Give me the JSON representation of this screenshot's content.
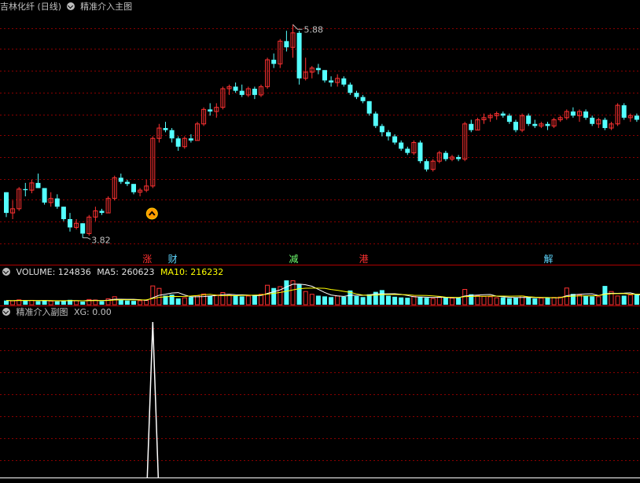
{
  "colors": {
    "background": "#000000",
    "up": "#ff3232",
    "down": "#54ffff",
    "grid": "#8a0000",
    "ma5": "#ffffff",
    "ma10": "#ffff00",
    "text": "#c0c0c0",
    "signal": "#ffffff"
  },
  "main_panel": {
    "stock_name": "吉林化纤",
    "period": "(日线)",
    "indicator": "精准介入主图",
    "high_label": "5.88",
    "low_label": "3.82",
    "buy_marker_icon": "chevron-up-icon",
    "news_labels": [
      {
        "text": "涨",
        "color": "#ff3030"
      },
      {
        "text": "财",
        "color": "#5fd7ff"
      },
      {
        "text": "减",
        "color": "#6fff6f"
      },
      {
        "text": "港",
        "color": "#ff3030"
      },
      {
        "text": "解",
        "color": "#5fd7ff"
      }
    ]
  },
  "volume_panel": {
    "label": "VOLUME: 124836",
    "ma5_label": "MA5: 260623",
    "ma10_label": "MA10: 216232"
  },
  "sub_panel": {
    "indicator": "精准介入副图",
    "xg_label": "XG: 0.00"
  },
  "chart_data": [
    {
      "type": "candlestick",
      "title": "吉林化纤 (日线)",
      "price_high": 5.88,
      "price_low": 3.82,
      "ohlc": [
        [
          4.26,
          4.26,
          4.02,
          4.06
        ],
        [
          4.06,
          4.18,
          4.0,
          4.1
        ],
        [
          4.1,
          4.31,
          4.08,
          4.29
        ],
        [
          4.29,
          4.35,
          4.22,
          4.28
        ],
        [
          4.28,
          4.38,
          4.25,
          4.35
        ],
        [
          4.35,
          4.44,
          4.3,
          4.3
        ],
        [
          4.3,
          4.3,
          4.14,
          4.16
        ],
        [
          4.16,
          4.26,
          4.12,
          4.2
        ],
        [
          4.2,
          4.24,
          4.1,
          4.12
        ],
        [
          4.12,
          4.12,
          3.98,
          4.0
        ],
        [
          4.0,
          4.06,
          3.88,
          3.92
        ],
        [
          3.92,
          4.0,
          3.9,
          3.96
        ],
        [
          3.96,
          3.96,
          3.82,
          3.86
        ],
        [
          3.86,
          4.04,
          3.84,
          4.02
        ],
        [
          4.02,
          4.12,
          3.98,
          4.08
        ],
        [
          4.08,
          4.1,
          4.04,
          4.06
        ],
        [
          4.06,
          4.22,
          4.06,
          4.2
        ],
        [
          4.2,
          4.42,
          4.18,
          4.4
        ],
        [
          4.4,
          4.44,
          4.34,
          4.36
        ],
        [
          4.36,
          4.38,
          4.32,
          4.34
        ],
        [
          4.34,
          4.34,
          4.24,
          4.26
        ],
        [
          4.26,
          4.3,
          4.22,
          4.28
        ],
        [
          4.28,
          4.38,
          4.26,
          4.32
        ],
        [
          4.32,
          4.8,
          4.3,
          4.78
        ],
        [
          4.78,
          4.92,
          4.74,
          4.88
        ],
        [
          4.88,
          4.94,
          4.84,
          4.86
        ],
        [
          4.86,
          4.88,
          4.74,
          4.78
        ],
        [
          4.78,
          4.8,
          4.66,
          4.7
        ],
        [
          4.7,
          4.8,
          4.68,
          4.78
        ],
        [
          4.78,
          4.82,
          4.74,
          4.76
        ],
        [
          4.76,
          4.94,
          4.76,
          4.92
        ],
        [
          4.92,
          5.08,
          4.9,
          5.06
        ],
        [
          5.06,
          5.12,
          5.0,
          5.04
        ],
        [
          5.04,
          5.12,
          4.98,
          5.08
        ],
        [
          5.08,
          5.28,
          5.06,
          5.26
        ],
        [
          5.26,
          5.3,
          5.2,
          5.28
        ],
        [
          5.28,
          5.32,
          5.22,
          5.24
        ],
        [
          5.24,
          5.3,
          5.18,
          5.2
        ],
        [
          5.2,
          5.28,
          5.18,
          5.26
        ],
        [
          5.26,
          5.28,
          5.16,
          5.2
        ],
        [
          5.2,
          5.3,
          5.18,
          5.28
        ],
        [
          5.28,
          5.56,
          5.26,
          5.54
        ],
        [
          5.54,
          5.6,
          5.46,
          5.5
        ],
        [
          5.5,
          5.74,
          5.46,
          5.72
        ],
        [
          5.72,
          5.82,
          5.62,
          5.66
        ],
        [
          5.66,
          5.88,
          5.56,
          5.8
        ],
        [
          5.8,
          5.82,
          5.3,
          5.36
        ],
        [
          5.36,
          5.56,
          5.34,
          5.42
        ],
        [
          5.42,
          5.48,
          5.36,
          5.46
        ],
        [
          5.46,
          5.5,
          5.4,
          5.44
        ],
        [
          5.44,
          5.44,
          5.32,
          5.34
        ],
        [
          5.34,
          5.38,
          5.28,
          5.32
        ],
        [
          5.32,
          5.4,
          5.28,
          5.36
        ],
        [
          5.36,
          5.38,
          5.28,
          5.3
        ],
        [
          5.3,
          5.32,
          5.2,
          5.22
        ],
        [
          5.22,
          5.24,
          5.16,
          5.18
        ],
        [
          5.18,
          5.2,
          5.12,
          5.14
        ],
        [
          5.14,
          5.14,
          5.0,
          5.02
        ],
        [
          5.02,
          5.04,
          4.88,
          4.9
        ],
        [
          4.9,
          4.92,
          4.8,
          4.84
        ],
        [
          4.84,
          4.86,
          4.76,
          4.8
        ],
        [
          4.8,
          4.82,
          4.72,
          4.74
        ],
        [
          4.74,
          4.76,
          4.66,
          4.68
        ],
        [
          4.68,
          4.7,
          4.62,
          4.64
        ],
        [
          4.64,
          4.76,
          4.62,
          4.74
        ],
        [
          4.74,
          4.76,
          4.54,
          4.56
        ],
        [
          4.56,
          4.58,
          4.46,
          4.48
        ],
        [
          4.48,
          4.58,
          4.46,
          4.56
        ],
        [
          4.56,
          4.66,
          4.54,
          4.64
        ],
        [
          4.64,
          4.66,
          4.56,
          4.58
        ],
        [
          4.58,
          4.62,
          4.56,
          4.6
        ],
        [
          4.6,
          4.62,
          4.56,
          4.58
        ],
        [
          4.58,
          4.94,
          4.56,
          4.92
        ],
        [
          4.92,
          4.96,
          4.84,
          4.86
        ],
        [
          4.86,
          4.98,
          4.86,
          4.96
        ],
        [
          4.96,
          5.02,
          4.92,
          4.98
        ],
        [
          4.98,
          5.02,
          4.94,
          5.0
        ],
        [
          5.0,
          5.04,
          4.96,
          5.02
        ],
        [
          5.02,
          5.04,
          4.98,
          5.0
        ],
        [
          5.0,
          5.02,
          4.92,
          4.94
        ],
        [
          4.94,
          4.96,
          4.84,
          4.86
        ],
        [
          4.86,
          5.02,
          4.84,
          5.0
        ],
        [
          5.0,
          5.02,
          4.9,
          4.92
        ],
        [
          4.92,
          4.96,
          4.88,
          4.9
        ],
        [
          4.9,
          4.94,
          4.88,
          4.92
        ],
        [
          4.92,
          4.94,
          4.86,
          4.9
        ],
        [
          4.9,
          4.98,
          4.88,
          4.96
        ],
        [
          4.96,
          5.0,
          4.94,
          4.98
        ],
        [
          4.98,
          5.06,
          4.96,
          5.04
        ],
        [
          5.04,
          5.08,
          4.98,
          5.0
        ],
        [
          5.0,
          5.06,
          4.94,
          5.04
        ],
        [
          5.04,
          5.06,
          4.96,
          4.98
        ],
        [
          4.98,
          5.0,
          4.9,
          4.92
        ],
        [
          4.92,
          4.98,
          4.88,
          4.96
        ],
        [
          4.96,
          4.98,
          4.86,
          4.88
        ],
        [
          4.88,
          4.94,
          4.86,
          4.92
        ],
        [
          4.92,
          5.12,
          4.9,
          5.1
        ],
        [
          5.1,
          5.12,
          4.96,
          4.98
        ],
        [
          4.98,
          5.02,
          4.94,
          5.0
        ],
        [
          5.0,
          5.02,
          4.94,
          4.96
        ],
        [
          4.96,
          4.98,
          4.84,
          4.86
        ]
      ],
      "volume": [
        120,
        110,
        140,
        115,
        125,
        100,
        130,
        105,
        95,
        120,
        140,
        115,
        90,
        150,
        135,
        100,
        170,
        230,
        150,
        120,
        110,
        115,
        125,
        540,
        470,
        260,
        290,
        180,
        200,
        220,
        260,
        310,
        260,
        280,
        350,
        290,
        260,
        240,
        250,
        270,
        300,
        560,
        480,
        520,
        700,
        690,
        580,
        380,
        300,
        260,
        240,
        220,
        250,
        230,
        410,
        250,
        220,
        300,
        370,
        420,
        260,
        230,
        210,
        200,
        240,
        230,
        200,
        180,
        220,
        210,
        190,
        200,
        440,
        300,
        260,
        240,
        230,
        200,
        210,
        190,
        200,
        250,
        210,
        180,
        190,
        200,
        210,
        220,
        480,
        310,
        280,
        260,
        240,
        230,
        540,
        380,
        250,
        260,
        280,
        300,
        290
      ],
      "xg_signal_index": 23
    }
  ]
}
